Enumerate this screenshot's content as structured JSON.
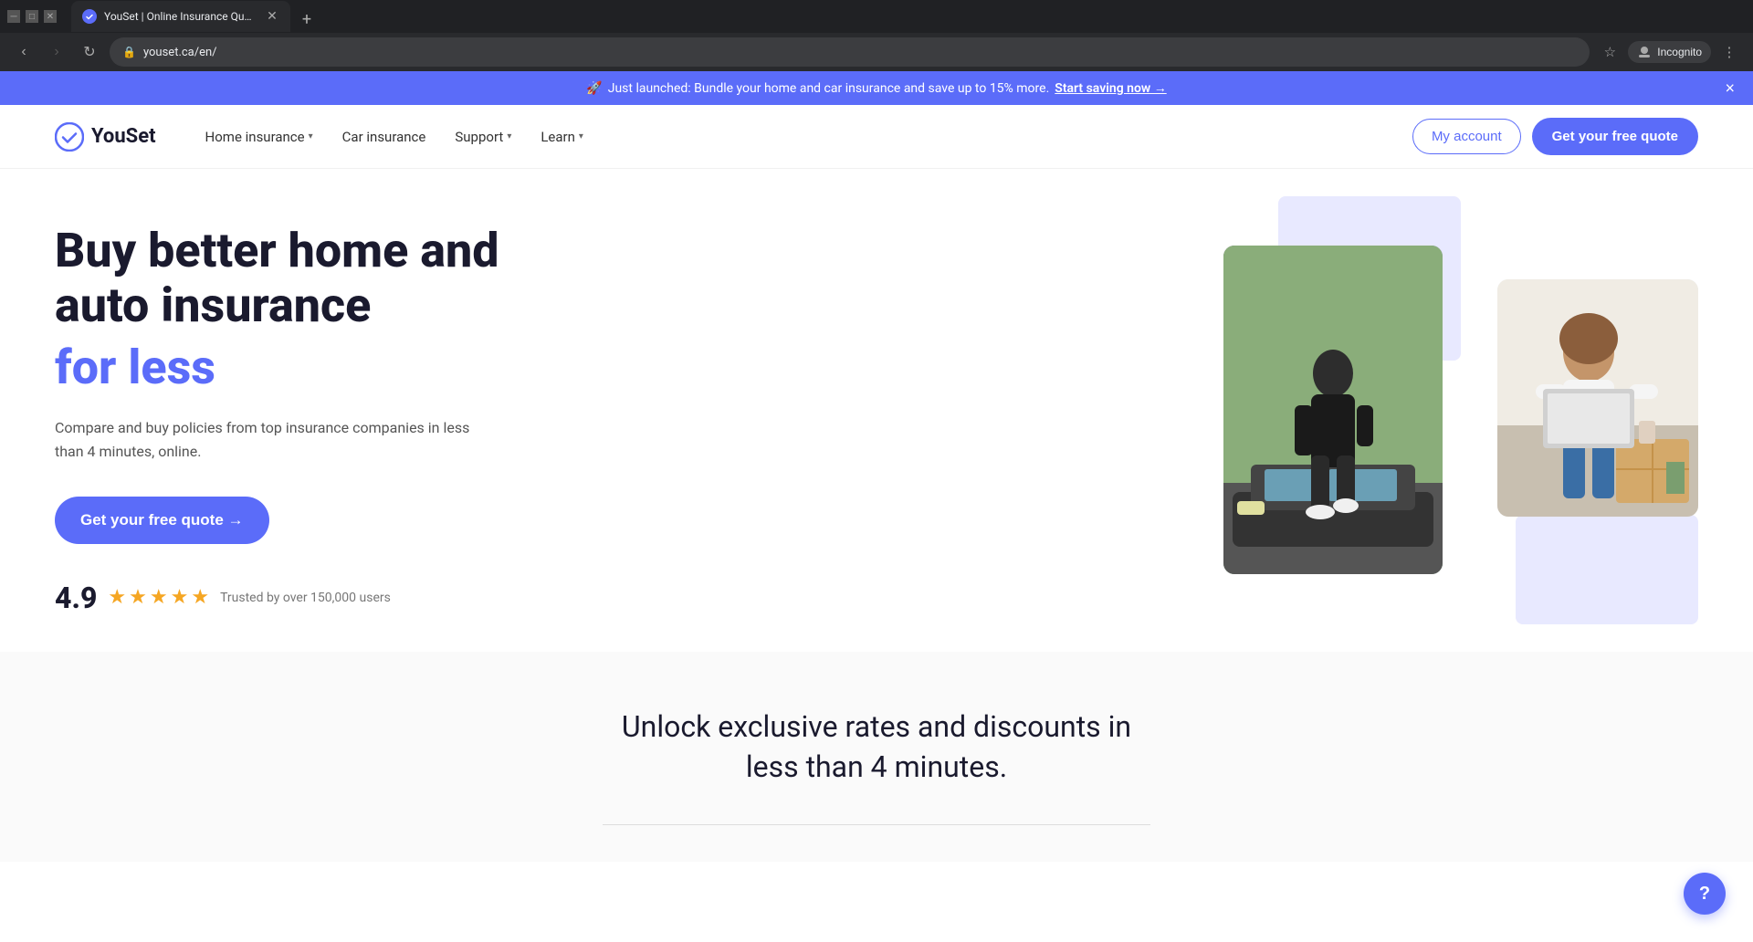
{
  "browser": {
    "tab_title": "YouSet | Online Insurance Quo...",
    "tab_favicon": "Y",
    "url": "youset.ca/en/",
    "new_tab_label": "+",
    "back_disabled": false,
    "forward_disabled": true,
    "incognito_label": "Incognito"
  },
  "banner": {
    "rocket_emoji": "🚀",
    "text": "Just launched: Bundle your home and car insurance and save up to 15% more.",
    "link_text": "Start saving now →",
    "close_label": "×"
  },
  "navbar": {
    "logo_text": "YouSet",
    "nav_items": [
      {
        "id": "home-insurance",
        "label": "Home insurance",
        "has_dropdown": true
      },
      {
        "id": "car-insurance",
        "label": "Car insurance",
        "has_dropdown": false
      },
      {
        "id": "support",
        "label": "Support",
        "has_dropdown": true
      },
      {
        "id": "learn",
        "label": "Learn",
        "has_dropdown": true
      }
    ],
    "my_account_label": "My account",
    "get_quote_label": "Get your free quote"
  },
  "hero": {
    "title_line1": "Buy better home and",
    "title_line2": "auto insurance",
    "title_accent": "for less",
    "subtitle": "Compare and buy policies from top insurance companies in less than 4 minutes, online.",
    "cta_label": "Get your free quote →",
    "rating_number": "4.9",
    "stars": [
      "★",
      "★",
      "★",
      "★",
      "★"
    ],
    "rating_trust": "Trusted by over 150,000 users"
  },
  "bottom": {
    "title": "Unlock exclusive rates and discounts in less than 4 minutes."
  },
  "help": {
    "label": "?"
  },
  "colors": {
    "accent": "#5b6cf9",
    "dark": "#1a1a2e",
    "muted": "#777777",
    "star": "#f5a623",
    "banner_bg": "#5b6cf9"
  }
}
